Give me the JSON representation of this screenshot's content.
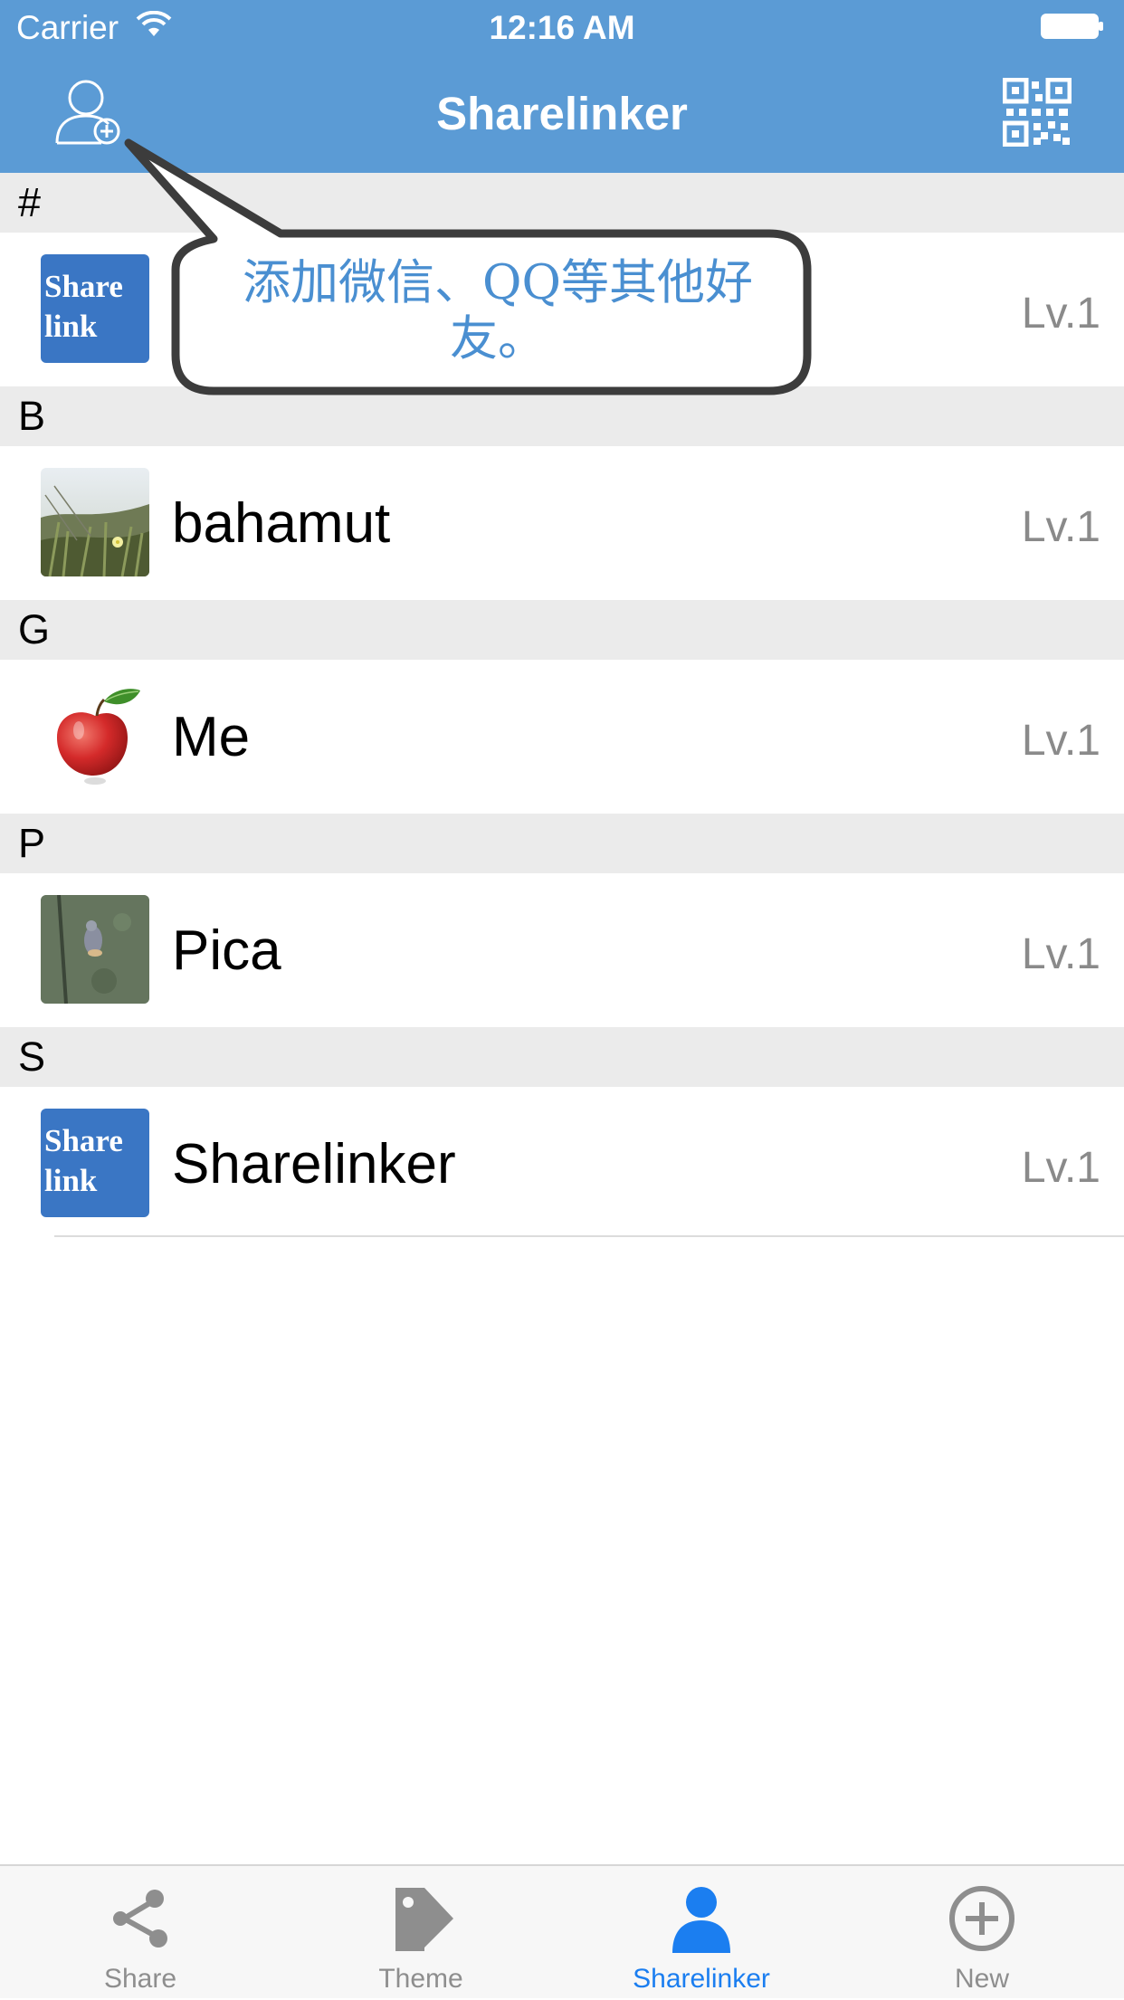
{
  "status": {
    "carrier": "Carrier",
    "time": "12:16 AM"
  },
  "nav": {
    "title": "Sharelinker",
    "add_friend_icon": "add-user-icon",
    "qr_icon": "qr-code-icon"
  },
  "colors": {
    "nav_bg": "#5b9bd5",
    "section_bg": "#ebebeb",
    "tab_active": "#1b7ef0",
    "tab_inactive": "#8e8e8e",
    "callout_text": "#4a8fd1"
  },
  "callout": {
    "text": "添加微信、QQ等其他好友。"
  },
  "sections": [
    {
      "header": "#",
      "rows": [
        {
          "name": "",
          "level": "Lv.1",
          "avatar": "sharelink-logo",
          "avatar_text_1": "Share",
          "avatar_text_2": "link"
        }
      ]
    },
    {
      "header": "B",
      "rows": [
        {
          "name": "bahamut",
          "level": "Lv.1",
          "avatar": "grass-photo"
        }
      ]
    },
    {
      "header": "G",
      "rows": [
        {
          "name": "Me",
          "level": "Lv.1",
          "avatar": "apple-photo"
        }
      ]
    },
    {
      "header": "P",
      "rows": [
        {
          "name": "Pica",
          "level": "Lv.1",
          "avatar": "bird-photo"
        }
      ]
    },
    {
      "header": "S",
      "rows": [
        {
          "name": "Sharelinker",
          "level": "Lv.1",
          "avatar": "sharelink-logo",
          "avatar_text_1": "Share",
          "avatar_text_2": "link"
        }
      ]
    }
  ],
  "tabs": [
    {
      "label": "Share",
      "icon": "share-icon",
      "active": false
    },
    {
      "label": "Theme",
      "icon": "tag-icon",
      "active": false
    },
    {
      "label": "Sharelinker",
      "icon": "person-icon",
      "active": true
    },
    {
      "label": "New",
      "icon": "plus-circle-icon",
      "active": false
    }
  ]
}
